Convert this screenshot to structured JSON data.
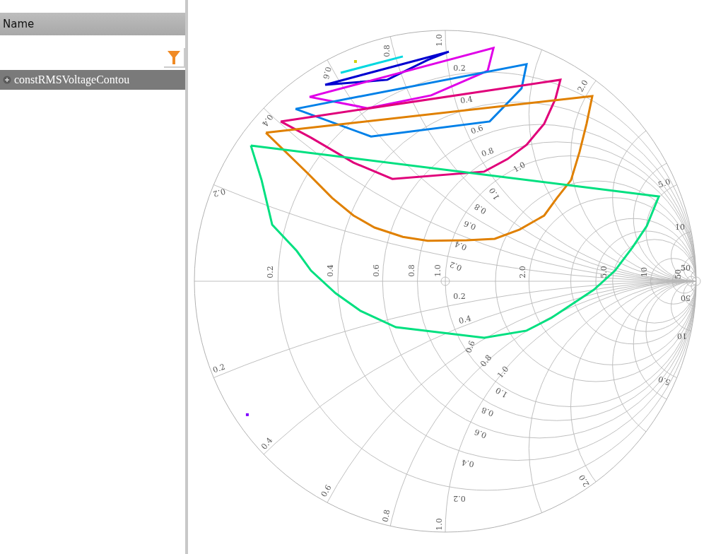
{
  "sidebar": {
    "header": "Name",
    "tree": [
      {
        "label": "constRMSVoltageContou",
        "selected": true,
        "expanded": false
      }
    ]
  },
  "smith_chart": {
    "rim_upper": [
      "0.2",
      "0.4",
      "0.6",
      "0.8",
      "1.0",
      "2.0",
      "5.0",
      "10",
      "50"
    ],
    "rim_lower": [
      "0.2",
      "0.4",
      "0.6",
      "0.8",
      "1.0",
      "2.0",
      "5.0",
      "10",
      "50"
    ],
    "axis": [
      "0.2",
      "0.4",
      "0.6",
      "0.8",
      "1.0",
      "2.0",
      "5.0",
      "10",
      "50"
    ],
    "inner_upper_far": [
      "0.2",
      "0.4",
      "0.6",
      "0.8",
      "1.0"
    ],
    "inner_upper_near": [
      "0.2",
      "0.4",
      "0.6",
      "0.8",
      "1.0"
    ],
    "inner_lower_near": [
      "0.2",
      "0.4",
      "0.6",
      "0.8",
      "1.0"
    ],
    "inner_lower_far": [
      "0.2",
      "0.4",
      "0.6",
      "0.8",
      "1.0"
    ],
    "contours": [
      {
        "color": "#00d8e0"
      },
      {
        "color": "#0000d0"
      },
      {
        "color": "#e000e8"
      },
      {
        "color": "#0080e8"
      },
      {
        "color": "#e0007a"
      },
      {
        "color": "#e08000"
      },
      {
        "color": "#00e080"
      }
    ],
    "markers": [
      {
        "color": "#d0d000"
      },
      {
        "color": "#8000ff"
      }
    ]
  }
}
